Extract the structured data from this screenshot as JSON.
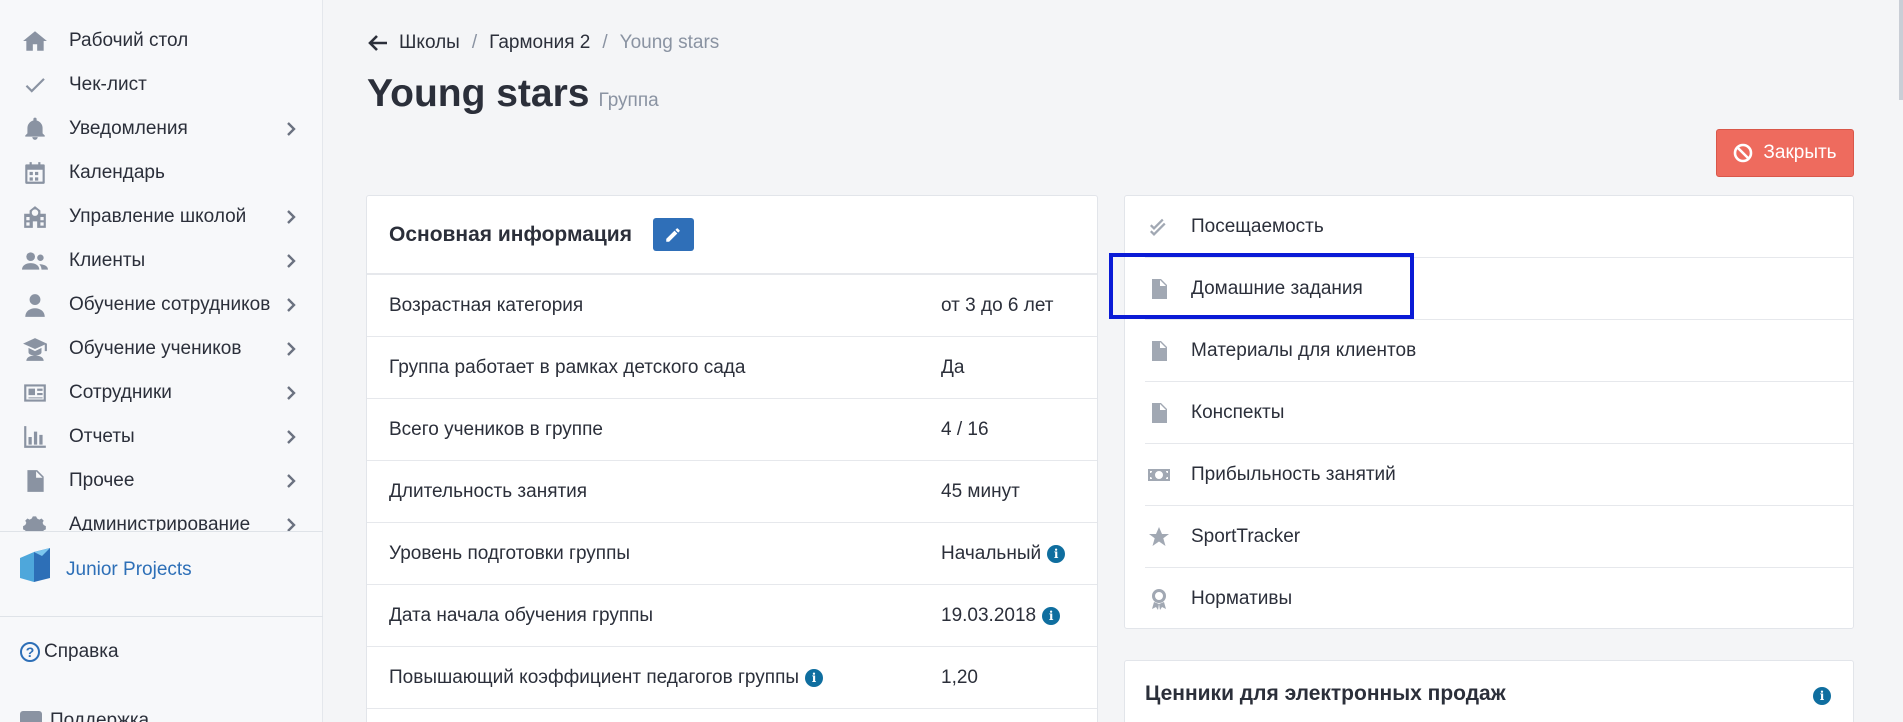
{
  "sidebar": {
    "items": [
      {
        "label": "Рабочий стол",
        "icon": "home-icon",
        "has_submenu": false
      },
      {
        "label": "Чек-лист",
        "icon": "check-icon",
        "has_submenu": false
      },
      {
        "label": "Уведомления",
        "icon": "bell-icon",
        "has_submenu": true
      },
      {
        "label": "Календарь",
        "icon": "calendar-icon",
        "has_submenu": false
      },
      {
        "label": "Управление школой",
        "icon": "school-icon",
        "has_submenu": true
      },
      {
        "label": "Клиенты",
        "icon": "users-icon",
        "has_submenu": true
      },
      {
        "label": "Обучение сотрудников",
        "icon": "teacher-icon",
        "has_submenu": true
      },
      {
        "label": "Обучение учеников",
        "icon": "graduate-icon",
        "has_submenu": true
      },
      {
        "label": "Сотрудники",
        "icon": "id-card-icon",
        "has_submenu": true
      },
      {
        "label": "Отчеты",
        "icon": "chart-icon",
        "has_submenu": true
      },
      {
        "label": "Прочее",
        "icon": "file-icon",
        "has_submenu": true
      },
      {
        "label": "Администрирование",
        "icon": "cogs-icon",
        "has_submenu": true
      }
    ],
    "brand": {
      "name": "Junior Projects"
    },
    "help_label": "Справка",
    "support_label": "Поддержка"
  },
  "breadcrumb": {
    "items": [
      "Школы",
      "Гармония 2"
    ],
    "current": "Young stars",
    "separator": "/"
  },
  "page": {
    "title": "Young stars",
    "subtitle": "Группа",
    "close_label": "Закрыть"
  },
  "info": {
    "title": "Основная информация",
    "rows": [
      {
        "label": "Возрастная категория",
        "value": "от 3 до 6 лет",
        "label_info": false,
        "value_info": false
      },
      {
        "label": "Группа работает в рамках детского сада",
        "value": "Да",
        "label_info": false,
        "value_info": false
      },
      {
        "label": "Всего учеников в группе",
        "value": "4 / 16",
        "label_info": false,
        "value_info": false
      },
      {
        "label": "Длительность занятия",
        "value": "45 минут",
        "label_info": false,
        "value_info": false
      },
      {
        "label": "Уровень подготовки группы",
        "value": "Начальный",
        "label_info": false,
        "value_info": true
      },
      {
        "label": "Дата начала обучения группы",
        "value": "19.03.2018",
        "label_info": false,
        "value_info": true
      },
      {
        "label": "Повышающий коэффициент педагогов группы",
        "value": "1,20",
        "label_info": true,
        "value_info": false
      }
    ]
  },
  "tools": {
    "items": [
      {
        "label": "Посещаемость",
        "icon": "double-check-icon"
      },
      {
        "label": "Домашние задания",
        "icon": "document-icon"
      },
      {
        "label": "Материалы для клиентов",
        "icon": "file-icon"
      },
      {
        "label": "Конспекты",
        "icon": "file-icon"
      },
      {
        "label": "Прибыльность занятий",
        "icon": "money-icon"
      },
      {
        "label": "SportTracker",
        "icon": "star-icon"
      },
      {
        "label": "Нормативы",
        "icon": "award-icon"
      }
    ]
  },
  "prices": {
    "title": "Ценники для электронных продаж"
  },
  "colors": {
    "accent": "#2f6fb8",
    "danger": "#ee6b5e",
    "highlight": "#0a1bd6",
    "info": "#0f6e9f"
  }
}
